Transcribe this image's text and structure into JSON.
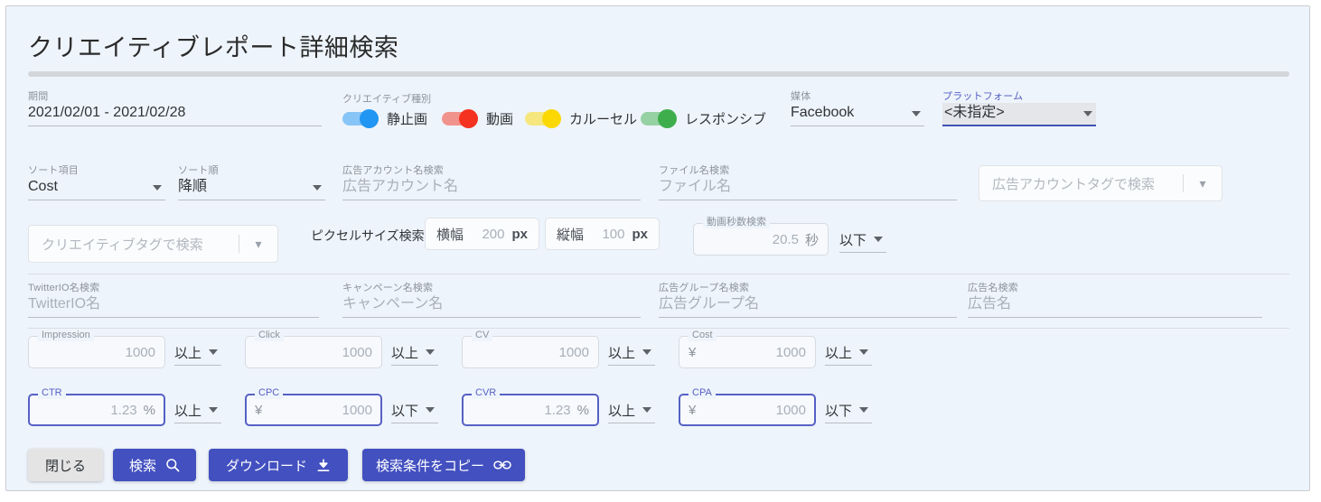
{
  "header": {
    "title": "クリエイティブレポート詳細検索"
  },
  "colors": {
    "card_bg": "#eef4fb",
    "primary": "#4350c0",
    "focus": "#5561c4",
    "toggle_image": "#2196f3",
    "toggle_video": "#f4321f",
    "toggle_carousel": "#fbd801",
    "toggle_responsive": "#3eae4d"
  },
  "row1": {
    "period": {
      "label": "期間",
      "value": "2021/02/01 - 2021/02/28"
    },
    "creative_type": {
      "label": "クリエイティブ種別",
      "toggles": [
        {
          "name": "static-image",
          "label": "静止画",
          "color": "#2196f3",
          "on": true
        },
        {
          "name": "video",
          "label": "動画",
          "color": "#f4321f",
          "on": true
        },
        {
          "name": "carousel",
          "label": "カルーセル",
          "color": "#fbd801",
          "on": true
        },
        {
          "name": "responsive",
          "label": "レスポンシブ",
          "color": "#3eae4d",
          "on": true
        }
      ]
    },
    "media": {
      "label": "媒体",
      "value": "Facebook"
    },
    "platform": {
      "label": "プラットフォーム",
      "value": "<未指定>",
      "focused": true
    }
  },
  "row2": {
    "sort_field": {
      "label": "ソート項目",
      "value": "Cost"
    },
    "sort_order": {
      "label": "ソート順",
      "value": "降順"
    },
    "ad_account_name": {
      "label": "広告アカウント名検索",
      "placeholder": "広告アカウント名"
    },
    "file_name": {
      "label": "ファイル名検索",
      "placeholder": "ファイル名"
    },
    "ad_account_tag": {
      "placeholder": "広告アカウントタグで検索",
      "chevron": "chevron-down-icon"
    }
  },
  "row3": {
    "creative_tag": {
      "placeholder": "クリエイティブタグで検索",
      "chevron": "chevron-down-icon"
    },
    "pixel_size": {
      "label": "ピクセルサイズ検索",
      "width": {
        "prefix": "横幅",
        "value": "200",
        "unit": "px"
      },
      "height": {
        "prefix": "縦幅",
        "value": "100",
        "unit": "px"
      }
    },
    "video_seconds": {
      "label": "動画秒数検索",
      "value": "20.5",
      "unit": "秒",
      "comparator": "以下"
    }
  },
  "row4": {
    "twitter_io": {
      "label": "TwitterIO名検索",
      "placeholder": "TwitterIO名"
    },
    "campaign": {
      "label": "キャンペーン名検索",
      "placeholder": "キャンペーン名"
    },
    "ad_group": {
      "label": "広告グループ名検索",
      "placeholder": "広告グループ名"
    },
    "ad_name": {
      "label": "広告名検索",
      "placeholder": "広告名"
    }
  },
  "metrics_row1": [
    {
      "name": "impression",
      "label": "Impression",
      "prefix": "",
      "value": "1000",
      "unit": "",
      "comparator": "以上",
      "focused": false
    },
    {
      "name": "click",
      "label": "Click",
      "prefix": "",
      "value": "1000",
      "unit": "",
      "comparator": "以上",
      "focused": false
    },
    {
      "name": "cv",
      "label": "CV",
      "prefix": "",
      "value": "1000",
      "unit": "",
      "comparator": "以上",
      "focused": false
    },
    {
      "name": "cost",
      "label": "Cost",
      "prefix": "¥",
      "value": "1000",
      "unit": "",
      "comparator": "以上",
      "focused": false
    }
  ],
  "metrics_row2": [
    {
      "name": "ctr",
      "label": "CTR",
      "prefix": "",
      "value": "1.23",
      "unit": "%",
      "comparator": "以上",
      "focused": true
    },
    {
      "name": "cpc",
      "label": "CPC",
      "prefix": "¥",
      "value": "1000",
      "unit": "",
      "comparator": "以下",
      "focused": true
    },
    {
      "name": "cvr",
      "label": "CVR",
      "prefix": "",
      "value": "1.23",
      "unit": "%",
      "comparator": "以上",
      "focused": true
    },
    {
      "name": "cpa",
      "label": "CPA",
      "prefix": "¥",
      "value": "1000",
      "unit": "",
      "comparator": "以下",
      "focused": true
    }
  ],
  "buttons": [
    {
      "name": "close",
      "label": "閉じる",
      "style": "grey",
      "icon": ""
    },
    {
      "name": "search",
      "label": "検索",
      "style": "blue",
      "icon": "search-icon"
    },
    {
      "name": "download",
      "label": "ダウンロード",
      "style": "blue",
      "icon": "download-icon"
    },
    {
      "name": "copy-conditions",
      "label": "検索条件をコピー",
      "style": "blue",
      "icon": "link-icon"
    }
  ]
}
